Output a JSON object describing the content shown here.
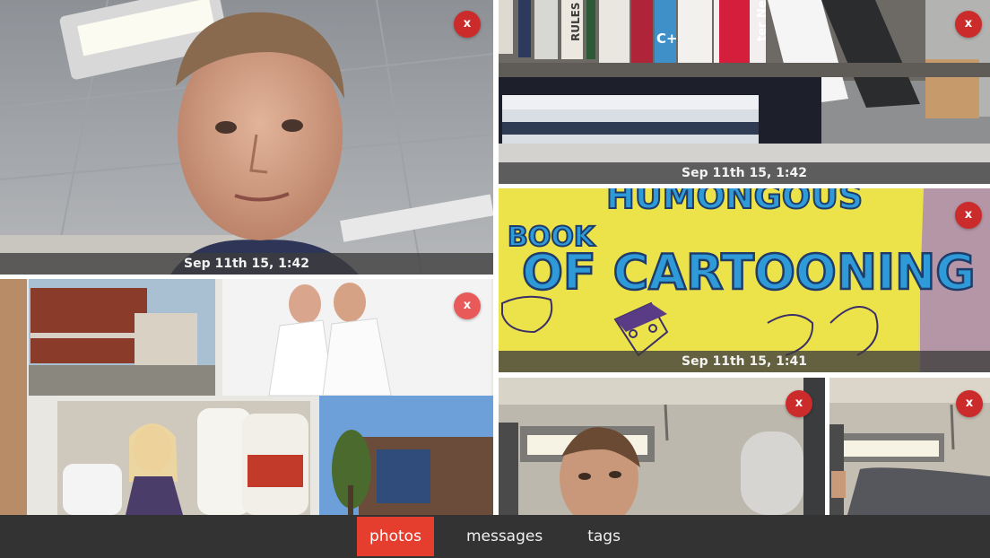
{
  "colors": {
    "accent": "#e53e2e",
    "close_button": "#cc2b2b",
    "bottom_bar": "#333333",
    "caption_bg": "#3c3c3c"
  },
  "photos": [
    {
      "caption": "Sep 11th 15, 1:42",
      "close_label": "x"
    },
    {
      "caption": "Sep 11th 15, 1:42",
      "close_label": "x"
    },
    {
      "caption": "",
      "close_label": "x"
    },
    {
      "caption": "Sep 11th 15, 1:41",
      "close_label": "x"
    },
    {
      "caption": "",
      "close_label": "x"
    },
    {
      "caption": "",
      "close_label": "x"
    }
  ],
  "tabs": [
    {
      "label": "photos",
      "active": true
    },
    {
      "label": "messages",
      "active": false
    },
    {
      "label": "tags",
      "active": false
    }
  ],
  "photo_texts": {
    "book_title_line1": "HUMONGOUS",
    "book_title_line2": "BOOK",
    "book_title_line3": "OF CARTOONING",
    "spine_networks": "ter Networks",
    "spine_cpp": "C++",
    "spine_rules": "RULES"
  }
}
